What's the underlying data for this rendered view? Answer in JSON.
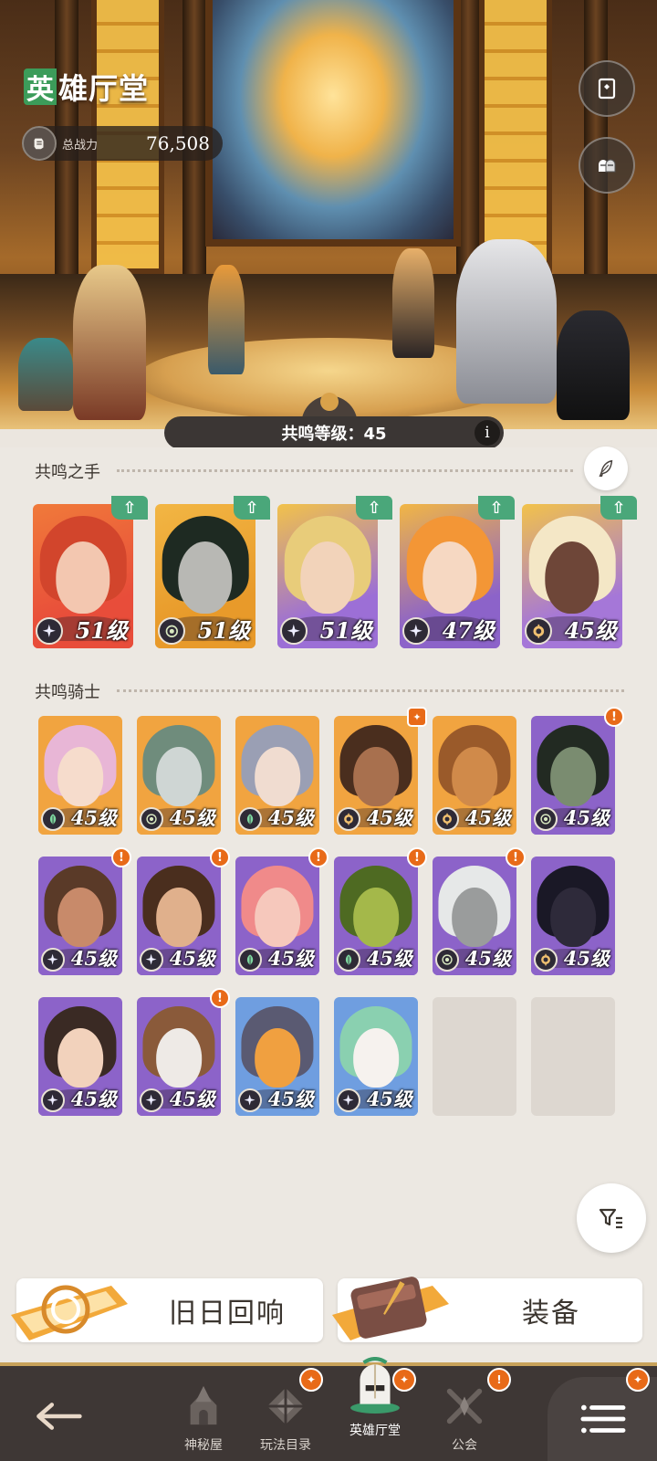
{
  "header": {
    "title_first_char": "英",
    "title_rest": "雄厅堂",
    "power_label": "总战力",
    "power_value": "76,508"
  },
  "resonance": {
    "level_text": "共鸣等级：45",
    "info_glyph": "i"
  },
  "hands_section": {
    "title": "共鸣之手",
    "cards": [
      {
        "level": "51级",
        "class_icon": "star-icon",
        "bg": "#e84d3a",
        "accent": "#f07a3a",
        "skin": "#f3c7b0",
        "hair": "#d2452c",
        "upgradable": true
      },
      {
        "level": "51级",
        "class_icon": "eye-icon",
        "bg": "#e89a2a",
        "accent": "#f2b644",
        "skin": "#b8b8b4",
        "hair": "#1e2a22",
        "upgradable": true
      },
      {
        "level": "51级",
        "class_icon": "star-icon",
        "bg": "#9c6fd6",
        "accent": "#f2c24a",
        "skin": "#f2d3ba",
        "hair": "#e8cc7a",
        "upgradable": true
      },
      {
        "level": "47级",
        "class_icon": "star-icon",
        "bg": "#8c63c9",
        "accent": "#f2b644",
        "skin": "#f6d8c2",
        "hair": "#f39636",
        "upgradable": true
      },
      {
        "level": "45级",
        "class_icon": "mind-icon",
        "bg": "#a577d8",
        "accent": "#f2c24a",
        "skin": "#6e4638",
        "hair": "#f4e7c6",
        "upgradable": true
      }
    ]
  },
  "knights_section": {
    "title": "共鸣骑士",
    "cards": [
      {
        "level": "45级",
        "class_icon": "leaf-icon",
        "bg": "#f1a440",
        "skin": "#f6dccc",
        "hair": "#e8b6d6",
        "badge": "none"
      },
      {
        "level": "45级",
        "class_icon": "eye-icon",
        "bg": "#f1a440",
        "skin": "#cfd6d4",
        "hair": "#6f8c7c",
        "badge": "none"
      },
      {
        "level": "45级",
        "class_icon": "leaf-icon",
        "bg": "#f1a440",
        "skin": "#f0dcd0",
        "hair": "#9a9fb4",
        "badge": "none"
      },
      {
        "level": "45级",
        "class_icon": "mind-icon",
        "bg": "#f1a440",
        "skin": "#a8704e",
        "hair": "#4a2e1e",
        "badge": "gift"
      },
      {
        "level": "45级",
        "class_icon": "mind-icon",
        "bg": "#f1a440",
        "skin": "#d08a4a",
        "hair": "#9a5a2a",
        "badge": "none"
      },
      {
        "level": "45级",
        "class_icon": "eye-icon",
        "bg": "#8c63c9",
        "skin": "#7a8c70",
        "hair": "#222a22",
        "badge": "alert"
      },
      {
        "level": "45级",
        "class_icon": "star-icon",
        "bg": "#8c63c9",
        "skin": "#c88a6a",
        "hair": "#5a3a28",
        "badge": "alert"
      },
      {
        "level": "45级",
        "class_icon": "star-icon",
        "bg": "#8c63c9",
        "skin": "#e0b08c",
        "hair": "#4a2e1e",
        "badge": "alert"
      },
      {
        "level": "45级",
        "class_icon": "leaf-icon",
        "bg": "#8c63c9",
        "skin": "#f6c8bc",
        "hair": "#f08a8a",
        "badge": "alert"
      },
      {
        "level": "45级",
        "class_icon": "leaf-icon",
        "bg": "#8c63c9",
        "skin": "#a4b84a",
        "hair": "#4e6a22",
        "badge": "alert"
      },
      {
        "level": "45级",
        "class_icon": "eye-icon",
        "bg": "#8c63c9",
        "skin": "#9a9c9c",
        "hair": "#e6e8e8",
        "badge": "alert"
      },
      {
        "level": "45级",
        "class_icon": "mind-icon",
        "bg": "#8c63c9",
        "skin": "#2e2a3a",
        "hair": "#1a1826",
        "badge": "none"
      },
      {
        "level": "45级",
        "class_icon": "star-icon",
        "bg": "#8c63c9",
        "skin": "#f2d2bc",
        "hair": "#3a2a24",
        "badge": "none"
      },
      {
        "level": "45级",
        "class_icon": "star-icon",
        "bg": "#8c63c9",
        "skin": "#eeeae6",
        "hair": "#8a5a3a",
        "badge": "alert"
      },
      {
        "level": "45级",
        "class_icon": "star-icon",
        "bg": "#6f9ee0",
        "skin": "#f0a040",
        "hair": "#5a5a72",
        "badge": "none"
      },
      {
        "level": "45级",
        "class_icon": "star-icon",
        "bg": "#6f9ee0",
        "skin": "#f6f2ee",
        "hair": "#8ad0b0",
        "badge": "none"
      }
    ],
    "empty_slots": 2
  },
  "actions": {
    "echoes_label": "旧日回响",
    "equipment_label": "装备"
  },
  "nav": {
    "items": [
      {
        "key": "mystery",
        "label": "神秘屋",
        "icon": "mystery-house-icon",
        "badge": "none"
      },
      {
        "key": "gameplay",
        "label": "玩法目录",
        "icon": "gameplay-catalog-icon",
        "badge": "gift"
      },
      {
        "key": "hall",
        "label": "英雄厅堂",
        "icon": "hero-hall-icon",
        "badge": "gift"
      },
      {
        "key": "guild",
        "label": "公会",
        "icon": "guild-icon",
        "badge": "alert"
      }
    ],
    "menu_badge": "gift"
  },
  "colors": {
    "up_tag": "#4aa77a",
    "alert": "#e86a18",
    "nav_bg": "#3e3735",
    "panel_bg": "#ece8e2"
  }
}
